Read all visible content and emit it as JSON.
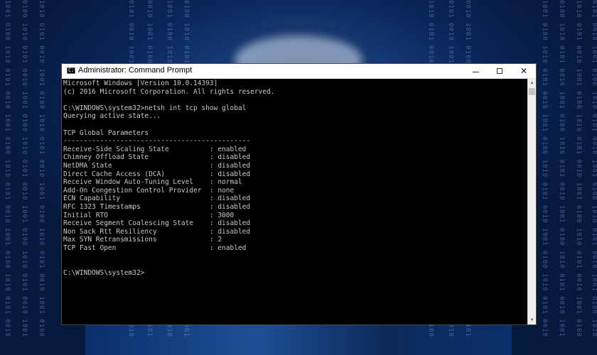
{
  "window": {
    "title": "Administrator: Command Prompt",
    "icon_label": "C:\\"
  },
  "controls": {
    "minimize": "minimize-icon",
    "maximize": "maximize-icon",
    "close_glyph": "✕"
  },
  "console": {
    "lines": [
      "Microsoft Windows [Version 10.0.14393]",
      "(c) 2016 Microsoft Corporation. All rights reserved.",
      "",
      "C:\\WINDOWS\\system32>netsh int tcp show global",
      "Querying active state...",
      "",
      "TCP Global Parameters",
      "----------------------------------------------",
      "Receive-Side Scaling State          : enabled",
      "Chimney Offload State               : disabled",
      "NetDMA State                        : disabled",
      "Direct Cache Access (DCA)           : disabled",
      "Receive Window Auto-Tuning Level    : normal",
      "Add-On Congestion Control Provider  : none",
      "ECN Capability                      : disabled",
      "RFC 1323 Timestamps                 : disabled",
      "Initial RTO                         : 3000",
      "Receive Segment Coalescing State    : disabled",
      "Non Sack Rtt Resiliency             : disabled",
      "Max SYN Retransmissions             : 2",
      "TCP Fast Open                       : enabled",
      "",
      "",
      "C:\\WINDOWS\\system32>"
    ]
  },
  "scrollbar": {
    "up_icon": "▲",
    "down_icon": "▼"
  },
  "colors": {
    "console_bg": "#000000",
    "console_text": "#c9c9c9",
    "titlebar_bg": "#ffffff"
  }
}
